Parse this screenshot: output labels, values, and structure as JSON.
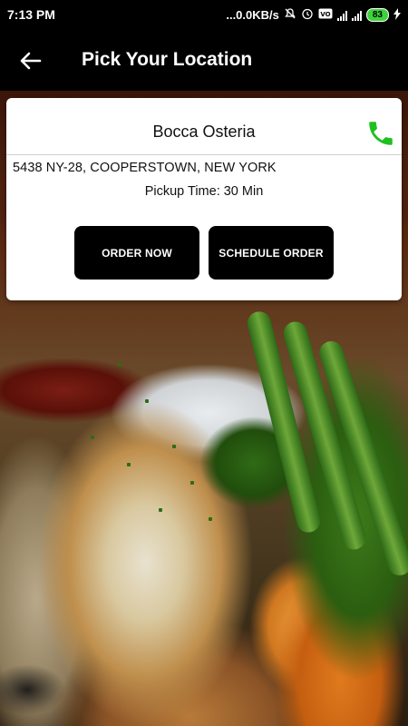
{
  "status_bar": {
    "time": "7:13 PM",
    "network_speed": "...0.0KB/s",
    "volte_label": "4G",
    "battery_level": "83"
  },
  "app_bar": {
    "title": "Pick Your Location",
    "back_icon": "arrow-left-icon"
  },
  "location_card": {
    "restaurant_name": "Bocca Osteria",
    "phone_icon": "phone-icon",
    "phone_icon_color": "#20c020",
    "address": "5438 NY-28, COOPERSTOWN, NEW YORK",
    "pickup_time": "Pickup Time: 30 Min",
    "order_now_label": "ORDER NOW",
    "schedule_order_label": "SCHEDULE ORDER"
  },
  "colors": {
    "app_bar_bg": "#000000",
    "button_bg": "#000000",
    "card_bg": "#ffffff",
    "battery_green": "#3cd43c"
  }
}
